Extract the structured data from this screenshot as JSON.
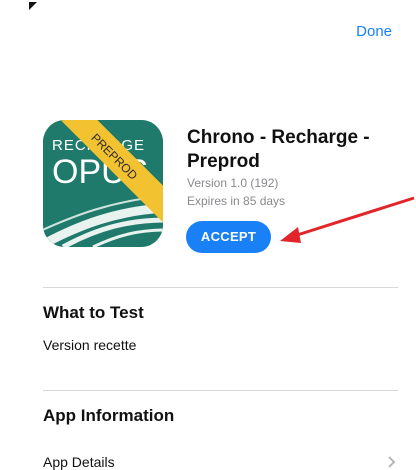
{
  "header": {
    "done_label": "Done"
  },
  "app": {
    "icon_top_text": "RECHARGE",
    "icon_main_text": "OPUS",
    "icon_ribbon_text": "PREPROD",
    "name": "Chrono - Recharge - Preprod",
    "version": "Version 1.0 (192)",
    "expires": "Expires in 85 days",
    "accept_label": "ACCEPT"
  },
  "what_to_test": {
    "title": "What to Test",
    "text": "Version recette"
  },
  "app_information": {
    "title": "App Information",
    "details_label": "App Details"
  },
  "colors": {
    "accent": "#1a80f6",
    "icon_bg": "#1f7a6c",
    "ribbon": "#f2c230",
    "arrow": "#e0262b"
  }
}
